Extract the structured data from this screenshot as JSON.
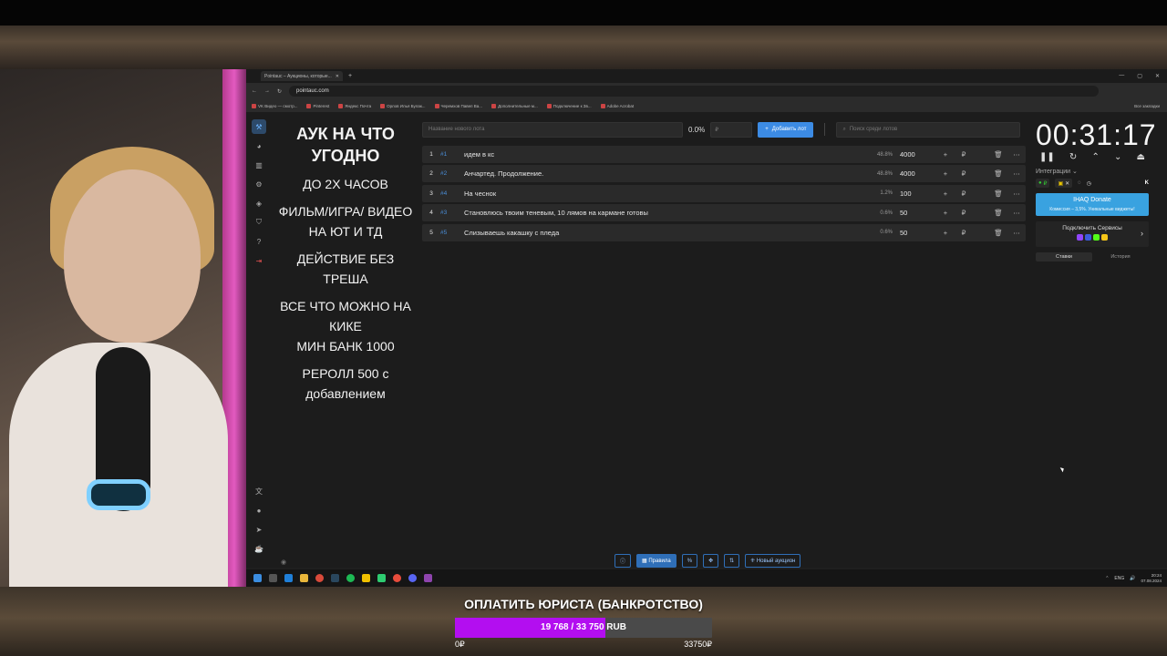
{
  "browser": {
    "tab_title": "Pointauc – Аукционы, которые...",
    "url": "pointauc.com",
    "bookmarks": [
      "VK Видео — смотр...",
      "Pinterest",
      "Яндекс Почта",
      "Орлов Илья Булак...",
      "Черемхов Павел Ва...",
      "Дополнительные м...",
      "Подключение к Зв...",
      "Adobe Acrobat"
    ],
    "bookmarks_all": "Все закладки"
  },
  "description": {
    "title": "АУК НА ЧТО УГОДНО",
    "lines": [
      "ДО 2Х ЧАСОВ",
      "ФИЛЬМ/ИГРА/ ВИДЕО НА ЮТ И ТД",
      "ДЕЙСТВИЕ БЕЗ ТРЕША",
      "ВСЕ ЧТО МОЖНО НА КИКЕ",
      "МИН БАНК 1000",
      "РЕРОЛЛ 500 с добавлением"
    ]
  },
  "controls": {
    "lot_placeholder": "Название нового лота",
    "percent": "0.0%",
    "amount_placeholder": "₽",
    "add_label": "Добавить лот",
    "search_placeholder": "Поиск среди лотов"
  },
  "lots": [
    {
      "n": "1",
      "id": "#1",
      "name": "идем в кс",
      "pct": "48.8%",
      "amount": "4000"
    },
    {
      "n": "2",
      "id": "#2",
      "name": "Анчартед. Продолжение.",
      "pct": "48.8%",
      "amount": "4000"
    },
    {
      "n": "3",
      "id": "#4",
      "name": "На чеснок",
      "pct": "1.2%",
      "amount": "100"
    },
    {
      "n": "4",
      "id": "#3",
      "name": "Становлюсь твоим теневым, 10 лямов на кармане готовы",
      "pct": "0.6%",
      "amount": "50"
    },
    {
      "n": "5",
      "id": "#5",
      "name": "Слизываешь какашку с пледа",
      "pct": "0.6%",
      "amount": "50"
    }
  ],
  "currency": "₽",
  "right": {
    "timer": "00:31:17",
    "integrations": "Интеграции",
    "donate_title": "IHAQ Donate",
    "donate_sub": "Комиссия – 3,5%. Уникальные виджеты!",
    "connect": "Подключить Сервисы",
    "tab_bids": "Ставки",
    "tab_history": "История"
  },
  "bottom": {
    "rules": "Правила",
    "new_auction": "Новый аукцион",
    "percent_sym": "%"
  },
  "taskbar": {
    "lang": "ENG",
    "time": "20:24",
    "date": "07.08.2024"
  },
  "goal": {
    "title": "ОПЛАТИТЬ ЮРИСТА (БАНКРОТСТВО)",
    "progress_text": "19 768 / 33 750 RUB",
    "current": 19768,
    "target": 33750,
    "min_label": "0₽",
    "max_label": "33750₽",
    "fill_color": "#b30ef0"
  }
}
